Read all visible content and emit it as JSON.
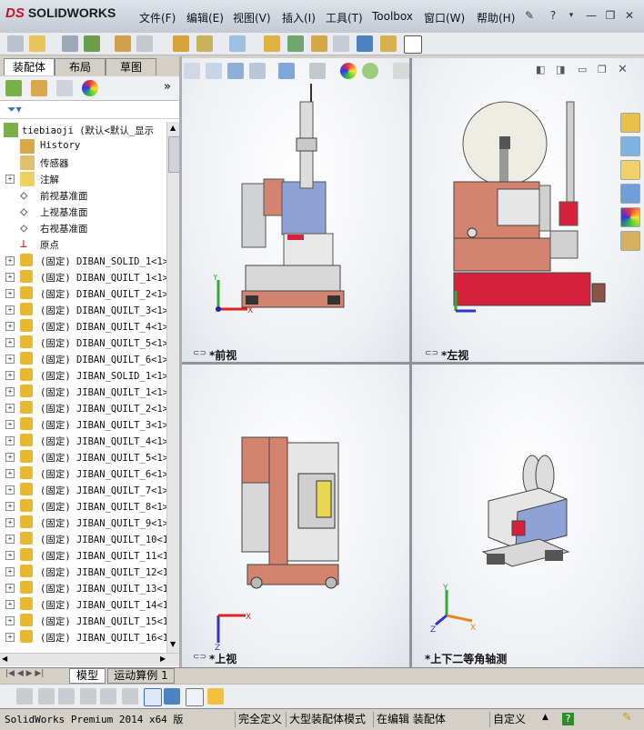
{
  "app": {
    "logo_ds": "DS",
    "logo_text": "SOLIDWORKS"
  },
  "menu": [
    {
      "label": "文件(F)",
      "name": "menu-file"
    },
    {
      "label": "编辑(E)",
      "name": "menu-edit"
    },
    {
      "label": "视图(V)",
      "name": "menu-view"
    },
    {
      "label": "插入(I)",
      "name": "menu-insert"
    },
    {
      "label": "工具(T)",
      "name": "menu-tools"
    },
    {
      "label": "Toolbox",
      "name": "menu-toolbox"
    },
    {
      "label": "窗口(W)",
      "name": "menu-window"
    },
    {
      "label": "帮助(H)",
      "name": "menu-help"
    }
  ],
  "panel_tabs": {
    "assembly": "装配体",
    "layout": "布局",
    "sketch": "草图"
  },
  "tree": {
    "root": "tiebiaoji  (默认<默认_显示",
    "items": [
      {
        "label": "History",
        "icon": "history-icon"
      },
      {
        "label": "传感器",
        "icon": "sensor-icon"
      },
      {
        "label": "注解",
        "icon": "annotation-icon"
      },
      {
        "label": "前视基准面",
        "icon": "plane-icon"
      },
      {
        "label": "上视基准面",
        "icon": "plane-icon"
      },
      {
        "label": "右视基准面",
        "icon": "plane-icon"
      },
      {
        "label": "原点",
        "icon": "origin-icon"
      },
      {
        "label": "(固定) DIBAN_SOLID_1<1>",
        "icon": "part-icon"
      },
      {
        "label": "(固定) DIBAN_QUILT_1<1>",
        "icon": "part-icon"
      },
      {
        "label": "(固定) DIBAN_QUILT_2<1>",
        "icon": "part-icon"
      },
      {
        "label": "(固定) DIBAN_QUILT_3<1>",
        "icon": "part-icon"
      },
      {
        "label": "(固定) DIBAN_QUILT_4<1>",
        "icon": "part-icon"
      },
      {
        "label": "(固定) DIBAN_QUILT_5<1>",
        "icon": "part-icon"
      },
      {
        "label": "(固定) DIBAN_QUILT_6<1>",
        "icon": "part-icon"
      },
      {
        "label": "(固定) JIBAN_SOLID_1<1>",
        "icon": "part-icon"
      },
      {
        "label": "(固定) JIBAN_QUILT_1<1>",
        "icon": "part-icon"
      },
      {
        "label": "(固定) JIBAN_QUILT_2<1>",
        "icon": "part-icon"
      },
      {
        "label": "(固定) JIBAN_QUILT_3<1>",
        "icon": "part-icon"
      },
      {
        "label": "(固定) JIBAN_QUILT_4<1>",
        "icon": "part-icon"
      },
      {
        "label": "(固定) JIBAN_QUILT_5<1>",
        "icon": "part-icon"
      },
      {
        "label": "(固定) JIBAN_QUILT_6<1>",
        "icon": "part-icon"
      },
      {
        "label": "(固定) JIBAN_QUILT_7<1>",
        "icon": "part-icon"
      },
      {
        "label": "(固定) JIBAN_QUILT_8<1>",
        "icon": "part-icon"
      },
      {
        "label": "(固定) JIBAN_QUILT_9<1>",
        "icon": "part-icon"
      },
      {
        "label": "(固定) JIBAN_QUILT_10<1",
        "icon": "part-icon"
      },
      {
        "label": "(固定) JIBAN_QUILT_11<1",
        "icon": "part-icon"
      },
      {
        "label": "(固定) JIBAN_QUILT_12<1",
        "icon": "part-icon"
      },
      {
        "label": "(固定) JIBAN_QUILT_13<1",
        "icon": "part-icon"
      },
      {
        "label": "(固定) JIBAN_QUILT_14<1",
        "icon": "part-icon"
      },
      {
        "label": "(固定) JIBAN_QUILT_15<1",
        "icon": "part-icon"
      },
      {
        "label": "(固定) JIBAN_QUILT_16<1",
        "icon": "part-icon"
      }
    ]
  },
  "viewports": {
    "front": "*前视",
    "left": "*左视",
    "top": "*上视",
    "iso": "*上下二等角轴测"
  },
  "axes": {
    "x": "X",
    "y": "Y",
    "z": "Z"
  },
  "bottom_tabs": {
    "model": "模型",
    "motion": "运动算例 1"
  },
  "status": {
    "version": "SolidWorks Premium 2014 x64 版",
    "defined": "完全定义",
    "mode": "大型装配体模式",
    "editing": "在编辑 装配体",
    "custom": "自定义",
    "help": "?"
  },
  "colors": {
    "accent": "#c8102e",
    "salmon": "#d4846e",
    "blue_part": "#8ea2d6",
    "red_part": "#d6213c"
  }
}
